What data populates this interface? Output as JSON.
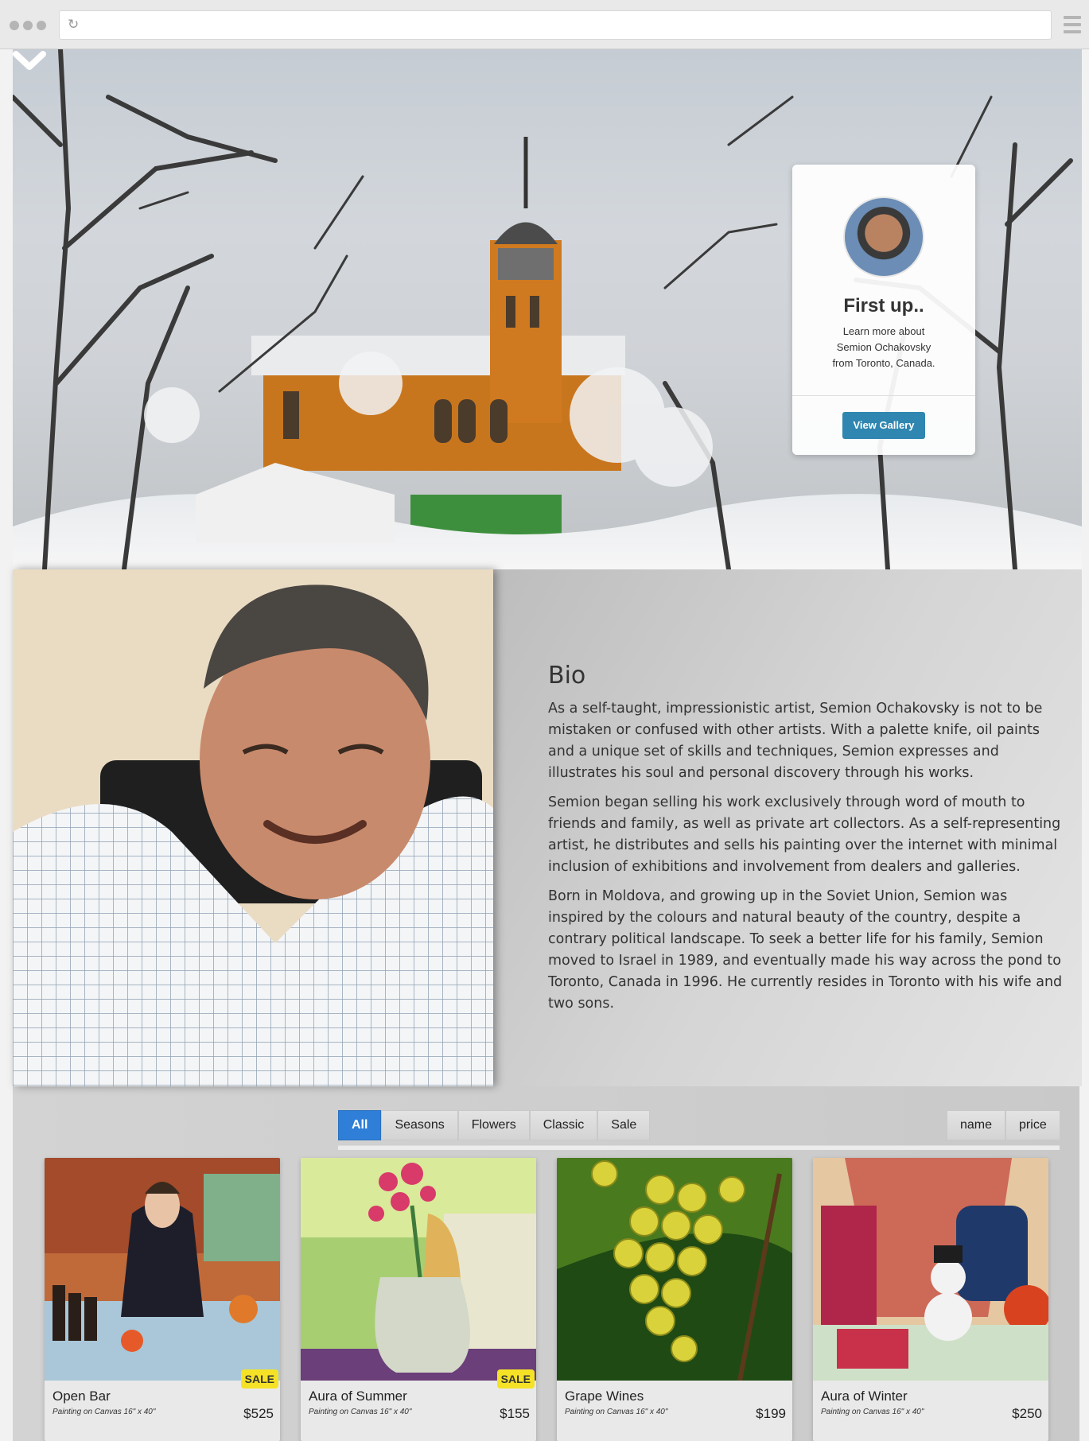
{
  "browser": {
    "reload_icon": "reload-icon",
    "menu_icon": "hamburger-menu-icon"
  },
  "hero": {
    "card": {
      "title": "First up..",
      "line1": "Learn more about",
      "line2": "Semion Ochakovsky",
      "line3": "from Toronto, Canada.",
      "button": "View Gallery"
    },
    "scroll_icon": "chevron-down-icon",
    "button_color": "#2f86b0"
  },
  "bio": {
    "heading": "Bio",
    "paragraphs": [
      "As a self-taught, impressionistic artist, Semion Ochakovsky is not to be mistaken or confused with other artists. With a palette knife, oil paints and a unique set of skills and techniques, Semion expresses and illustrates his soul and personal discovery through his works.",
      "Semion began selling his work exclusively through word of mouth to friends and family, as well as private art collectors. As a self-representing artist, he distributes and sells his painting over the internet with minimal inclusion of exhibitions and involvement from dealers and galleries.",
      "Born in Moldova, and growing up in the Soviet Union, Semion was inspired by the colours and natural beauty of the country, despite a contrary political landscape. To seek a better life for his family, Semion moved to Israel in 1989, and eventually made his way across the pond to Toronto, Canada in 1996. He currently resides in Toronto with his wife and two sons."
    ]
  },
  "gallery": {
    "filters": [
      "All",
      "Seasons",
      "Flowers",
      "Classic",
      "Sale"
    ],
    "active_filter": "All",
    "active_color": "#2f7fd8",
    "sort": [
      "name",
      "price"
    ],
    "items": [
      {
        "title": "Open Bar",
        "subtitle": "Painting on Canvas 16\" x 40\"",
        "price": "$525",
        "badge": "SALE"
      },
      {
        "title": "Aura of Summer",
        "subtitle": "Painting on Canvas 16\" x 40\"",
        "price": "$155",
        "badge": "SALE"
      },
      {
        "title": "Grape Wines",
        "subtitle": "Painting on Canvas 16\" x 40\"",
        "price": "$199",
        "badge": ""
      },
      {
        "title": "Aura of Winter",
        "subtitle": "Painting on Canvas 16\" x 40\"",
        "price": "$250",
        "badge": ""
      }
    ],
    "badge_color": "#f5e227"
  }
}
